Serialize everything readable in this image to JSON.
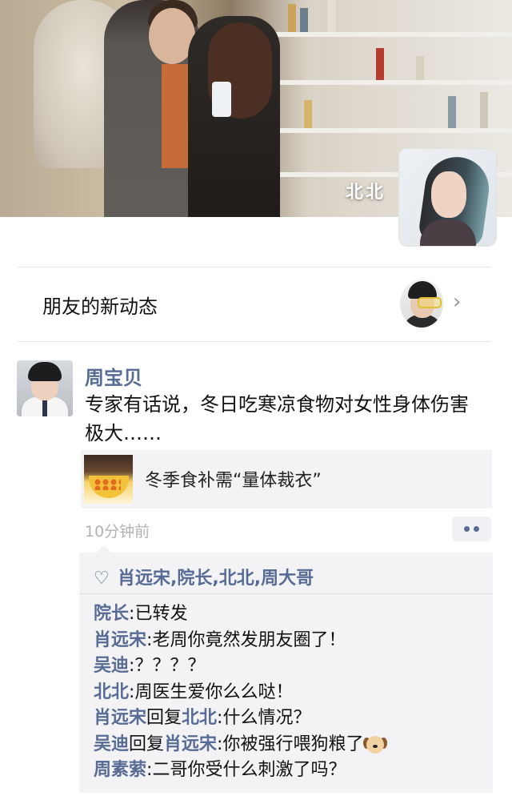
{
  "cover": {
    "profile_name": "北北"
  },
  "friends_updates": {
    "label": "朋友的新动态"
  },
  "post": {
    "author": "周宝贝",
    "text": "专家有话说，冬日吃寒凉食物对女性身体伤害极大……",
    "link": {
      "title": "冬季食补需“量体裁衣”"
    },
    "time": "10分钟前"
  },
  "likes": {
    "names": [
      "肖远宋",
      "院长",
      "北北",
      "周大哥"
    ],
    "separator": ","
  },
  "comments": [
    {
      "name": "院长",
      "sep": ":",
      "text": "已转发"
    },
    {
      "name": "肖远宋",
      "sep": ":",
      "text": "老周你竟然发朋友圈了！"
    },
    {
      "name": "吴迪",
      "sep": ":",
      "text": "？？？？"
    },
    {
      "name": "北北",
      "sep": ":",
      "text": "周医生爱你么么哒！"
    },
    {
      "name": "肖远宋",
      "reply_word": "回复",
      "reply_to": "北北",
      "sep": ":",
      "text": "什么情况？"
    },
    {
      "name": "吴迪",
      "reply_word": "回复",
      "reply_to": "肖远宋",
      "sep": ":",
      "text": "你被强行喂狗粮了",
      "emoji": "dog-icon"
    },
    {
      "name": "周素萦",
      "sep": ":",
      "text": "二哥你受什么刺激了吗？"
    }
  ],
  "colors": {
    "link_name": "#576b95",
    "time": "#b2b2b2",
    "comment_bg": "#f3f3f5"
  }
}
